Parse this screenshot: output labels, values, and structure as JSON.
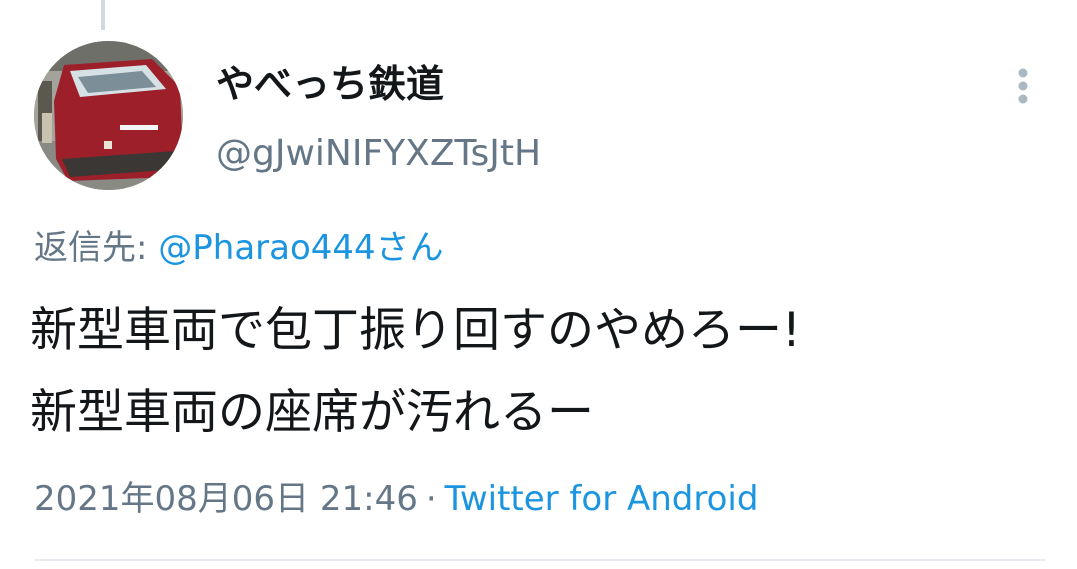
{
  "tweet": {
    "display_name": "やべっち鉄道",
    "handle": "@gJwiNIFYXZTsJtH",
    "reply_prefix": "返信先:",
    "reply_to": "@Pharao444さん",
    "text_lines": [
      "新型車両で包丁振り回すのやめろー!",
      "新型車両の座席が汚れるー"
    ],
    "timestamp": "2021年08月06日 21:46",
    "separator": "·",
    "source": "Twitter for Android"
  },
  "icons": {
    "avatar": "train-photo-avatar",
    "more": "more-vertical-icon"
  },
  "colors": {
    "text_primary": "#14171a",
    "text_secondary": "#657786",
    "link": "#1b95e0",
    "divider": "#e6ecf0"
  }
}
